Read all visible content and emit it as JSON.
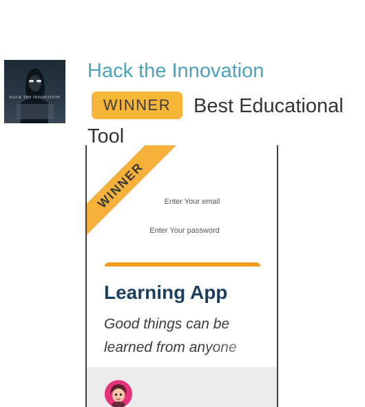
{
  "hackathon": {
    "name": "Hack the Innovation",
    "thumbnail_text": "HACK THE INNOVATION"
  },
  "prize": {
    "badge": "WINNER",
    "name": "Best Educational Tool"
  },
  "screenshot": {
    "ribbon": "WINNER",
    "email_placeholder": "Enter Your email",
    "password_placeholder": "Enter Your password",
    "app_title": "Learning App",
    "tagline": "Good things can be learned from anyone",
    "accent_color": "#f59b1e",
    "title_color": "#1d3f5e"
  },
  "colors": {
    "hackathon_link": "#4aa3bd",
    "winner_badge": "#f7b537"
  },
  "icons": [
    "hacker-avatar-icon",
    "user-avatar-icon"
  ]
}
